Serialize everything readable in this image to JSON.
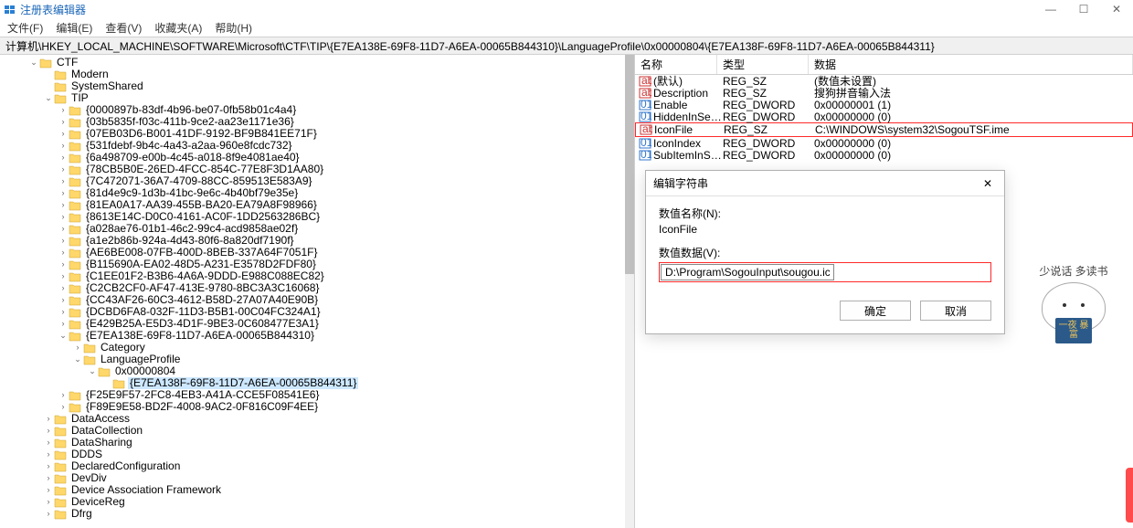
{
  "title": "注册表编辑器",
  "menu": [
    "文件(F)",
    "编辑(E)",
    "查看(V)",
    "收藏夹(A)",
    "帮助(H)"
  ],
  "address": "计算机\\HKEY_LOCAL_MACHINE\\SOFTWARE\\Microsoft\\CTF\\TIP\\{E7EA138E-69F8-11D7-A6EA-00065B844310}\\LanguageProfile\\0x00000804\\{E7EA138F-69F8-11D7-A6EA-00065B844311}",
  "tree": {
    "ctf": "CTF",
    "modern": "Modern",
    "systemshared": "SystemShared",
    "tip": "TIP",
    "tip_children": [
      "{0000897b-83df-4b96-be07-0fb58b01c4a4}",
      "{03b5835f-f03c-411b-9ce2-aa23e1171e36}",
      "{07EB03D6-B001-41DF-9192-BF9B841EE71F}",
      "{531fdebf-9b4c-4a43-a2aa-960e8fcdc732}",
      "{6a498709-e00b-4c45-a018-8f9e4081ae40}",
      "{78CB5B0E-26ED-4FCC-854C-77E8F3D1AA80}",
      "{7C472071-36A7-4709-88CC-859513E583A9}",
      "{81d4e9c9-1d3b-41bc-9e6c-4b40bf79e35e}",
      "{81EA0A17-AA39-455B-BA20-EA79A8F98966}",
      "{8613E14C-D0C0-4161-AC0F-1DD2563286BC}",
      "{a028ae76-01b1-46c2-99c4-acd9858ae02f}",
      "{a1e2b86b-924a-4d43-80f6-8a820df7190f}",
      "{AE6BE008-07FB-400D-8BEB-337A64F7051F}",
      "{B115690A-EA02-48D5-A231-E3578D2FDF80}",
      "{C1EE01F2-B3B6-4A6A-9DDD-E988C088EC82}",
      "{C2CB2CF0-AF47-413E-9780-8BC3A3C16068}",
      "{CC43AF26-60C3-4612-B58D-27A07A40E90B}",
      "{DCBD6FA8-032F-11D3-B5B1-00C04FC324A1}",
      "{E429B25A-E5D3-4D1F-9BE3-0C608477E3A1}"
    ],
    "e7ea": "{E7EA138E-69F8-11D7-A6EA-00065B844310}",
    "category": "Category",
    "langprofile": "LanguageProfile",
    "lang_sub": "0x00000804",
    "lang_leaf": "{E7EA138F-69F8-11D7-A6EA-00065B844311}",
    "tip_after": [
      "{F25E9F57-2FC8-4EB3-A41A-CCE5F08541E6}",
      "{F89E9E58-BD2F-4008-9AC2-0F816C09F4EE}"
    ],
    "after": [
      "DataAccess",
      "DataCollection",
      "DataSharing",
      "DDDS",
      "DeclaredConfiguration",
      "DevDiv",
      "Device Association Framework",
      "DeviceReg",
      "Dfrg"
    ]
  },
  "values": {
    "headers": {
      "name": "名称",
      "type": "类型",
      "data": "数据"
    },
    "rows": [
      {
        "icon": "ab",
        "name": "(默认)",
        "type": "REG_SZ",
        "data": "(数值未设置)"
      },
      {
        "icon": "ab",
        "name": "Description",
        "type": "REG_SZ",
        "data": "搜狗拼音输入法"
      },
      {
        "icon": "bin",
        "name": "Enable",
        "type": "REG_DWORD",
        "data": "0x00000001 (1)"
      },
      {
        "icon": "bin",
        "name": "HiddenInSettin...",
        "type": "REG_DWORD",
        "data": "0x00000000 (0)"
      },
      {
        "icon": "ab",
        "name": "IconFile",
        "type": "REG_SZ",
        "data": "C:\\WINDOWS\\system32\\SogouTSF.ime",
        "highlight": true
      },
      {
        "icon": "bin",
        "name": "IconIndex",
        "type": "REG_DWORD",
        "data": "0x00000000 (0)"
      },
      {
        "icon": "bin",
        "name": "SubItemInSettin...",
        "type": "REG_DWORD",
        "data": "0x00000000 (0)"
      }
    ]
  },
  "dialog": {
    "title": "编辑字符串",
    "name_label": "数值名称(N):",
    "name_value": "IconFile",
    "data_label": "数值数据(V):",
    "data_value": "D:\\Program\\SogouInput\\sougou.ico",
    "ok": "确定",
    "cancel": "取消"
  },
  "mascot": {
    "text": "少说话 多读书",
    "book": "一夜 暴富"
  }
}
